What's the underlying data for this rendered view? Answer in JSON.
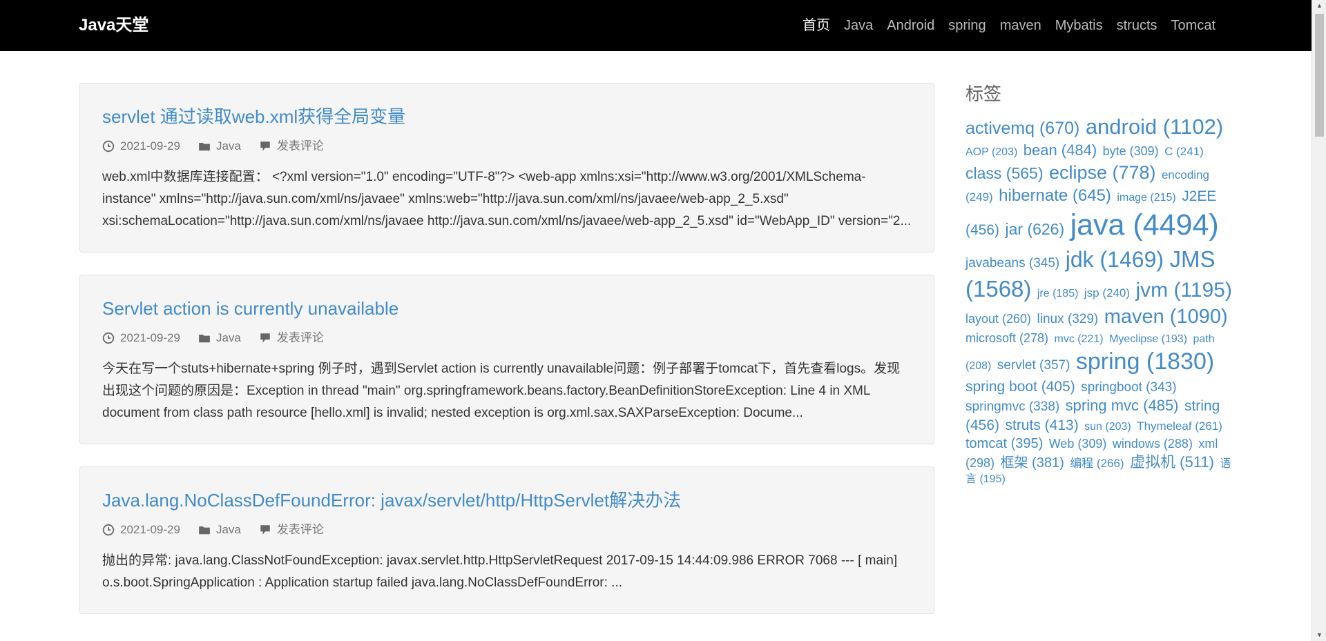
{
  "nav": {
    "brand": "Java天堂",
    "links": [
      {
        "label": "首页",
        "active": true
      },
      {
        "label": "Java"
      },
      {
        "label": "Android"
      },
      {
        "label": "spring"
      },
      {
        "label": "maven"
      },
      {
        "label": "Mybatis"
      },
      {
        "label": "structs"
      },
      {
        "label": "Tomcat"
      }
    ]
  },
  "posts": [
    {
      "title": "servlet 通过读取web.xml获得全局变量",
      "date": "2021-09-29",
      "category": "Java",
      "comment": "发表评论",
      "excerpt": "web.xml中数据库连接配置： <?xml version=\"1.0\" encoding=\"UTF-8\"?> <web-app xmlns:xsi=\"http://www.w3.org/2001/XMLSchema-instance\" xmlns=\"http://java.sun.com/xml/ns/javaee\" xmlns:web=\"http://java.sun.com/xml/ns/javaee/web-app_2_5.xsd\" xsi:schemaLocation=\"http://java.sun.com/xml/ns/javaee http://java.sun.com/xml/ns/javaee/web-app_2_5.xsd\" id=\"WebApp_ID\" version=\"2..."
    },
    {
      "title": "Servlet action is currently unavailable",
      "date": "2021-09-29",
      "category": "Java",
      "comment": "发表评论",
      "excerpt": "今天在写一个stuts+hibernate+spring 例子时，遇到Servlet action is currently unavailable问题：例子部署于tomcat下，首先查看logs。发现出现这个问题的原因是：Exception in thread \"main\" org.springframework.beans.factory.BeanDefinitionStoreException: Line 4 in XML document from class path resource [hello.xml] is invalid; nested exception is org.xml.sax.SAXParseException: Docume..."
    },
    {
      "title": "Java.lang.NoClassDefFoundError: javax/servlet/http/HttpServlet解决办法",
      "date": "2021-09-29",
      "category": "Java",
      "comment": "发表评论",
      "excerpt": "抛出的异常: java.lang.ClassNotFoundException: javax.servlet.http.HttpServletRequest 2017-09-15 14:44:09.986 ERROR 7068 --- [ main] o.s.boot.SpringApplication : Application startup failed java.lang.NoClassDefFoundError: ..."
    }
  ],
  "sidebar": {
    "title": "标签",
    "tags": [
      {
        "label": "activemq (670)",
        "size": 25
      },
      {
        "label": "android (1102)",
        "size": 31
      },
      {
        "label": "AOP (203)",
        "size": 16
      },
      {
        "label": "bean (484)",
        "size": 22
      },
      {
        "label": "byte (309)",
        "size": 18
      },
      {
        "label": "C (241)",
        "size": 17
      },
      {
        "label": "class (565)",
        "size": 23
      },
      {
        "label": "eclipse (778)",
        "size": 27
      },
      {
        "label": "encoding (249)",
        "size": 17
      },
      {
        "label": "hibernate (645)",
        "size": 24
      },
      {
        "label": "image (215)",
        "size": 16
      },
      {
        "label": "J2EE (456)",
        "size": 21
      },
      {
        "label": "jar (626)",
        "size": 23
      },
      {
        "label": "java (4494)",
        "size": 43
      },
      {
        "label": "javabeans (345)",
        "size": 19
      },
      {
        "label": "jdk (1469)",
        "size": 32
      },
      {
        "label": "JMS (1568)",
        "size": 33
      },
      {
        "label": "jre (185)",
        "size": 16
      },
      {
        "label": "jsp (240)",
        "size": 17
      },
      {
        "label": "jvm (1195)",
        "size": 30
      },
      {
        "label": "layout (260)",
        "size": 18
      },
      {
        "label": "linux (329)",
        "size": 19
      },
      {
        "label": "maven (1090)",
        "size": 29
      },
      {
        "label": "microsoft (278)",
        "size": 18
      },
      {
        "label": "mvc (221)",
        "size": 16
      },
      {
        "label": "Myeclipse (193)",
        "size": 16
      },
      {
        "label": "path (208)",
        "size": 16
      },
      {
        "label": "servlet (357)",
        "size": 19
      },
      {
        "label": "spring (1830)",
        "size": 34
      },
      {
        "label": "spring boot (405)",
        "size": 21
      },
      {
        "label": "springboot (343)",
        "size": 19
      },
      {
        "label": "springmvc (338)",
        "size": 19
      },
      {
        "label": "spring mvc (485)",
        "size": 22
      },
      {
        "label": "string (456)",
        "size": 21
      },
      {
        "label": "struts (413)",
        "size": 21
      },
      {
        "label": "sun (203)",
        "size": 16
      },
      {
        "label": "Thymeleaf (261)",
        "size": 17
      },
      {
        "label": "tomcat (395)",
        "size": 20
      },
      {
        "label": "Web (309)",
        "size": 18
      },
      {
        "label": "windows (288)",
        "size": 18
      },
      {
        "label": "xml (298)",
        "size": 18
      },
      {
        "label": "框架 (381)",
        "size": 20
      },
      {
        "label": "编程 (266)",
        "size": 17
      },
      {
        "label": "虚拟机 (511)",
        "size": 22
      },
      {
        "label": "语言 (195)",
        "size": 16
      }
    ]
  },
  "colors": {
    "accent": "#428bca",
    "nav_bg": "#000000",
    "card_bg": "#f5f5f5"
  }
}
